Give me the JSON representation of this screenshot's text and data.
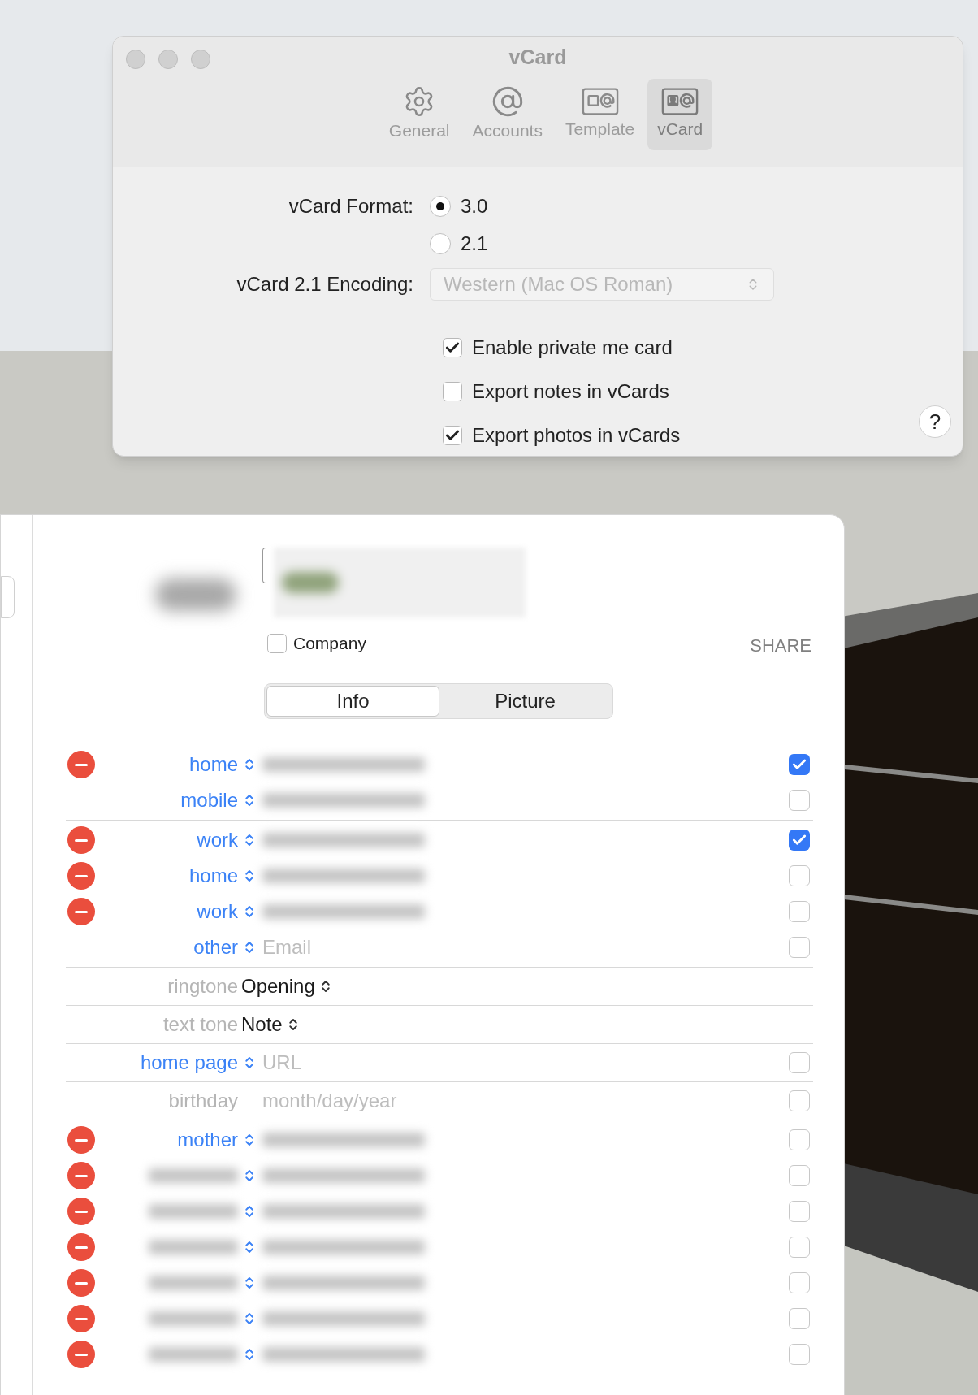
{
  "window": {
    "title": "vCard",
    "toolbar": [
      {
        "label": "General",
        "kind": "gear",
        "selected": false
      },
      {
        "label": "Accounts",
        "kind": "at",
        "selected": false
      },
      {
        "label": "Template",
        "kind": "template",
        "selected": false
      },
      {
        "label": "vCard",
        "kind": "card",
        "selected": true
      }
    ],
    "format_label": "vCard Format:",
    "formats": [
      {
        "label": "3.0",
        "selected": true
      },
      {
        "label": "2.1",
        "selected": false
      }
    ],
    "encoding_label": "vCard 2.1 Encoding:",
    "encoding": {
      "value": "Western (Mac OS Roman)",
      "disabled": true
    },
    "options": [
      {
        "label": "Enable private me card",
        "checked": true
      },
      {
        "label": "Export notes in vCards",
        "checked": false
      },
      {
        "label": "Export photos in vCards",
        "checked": true
      }
    ],
    "help": "?"
  },
  "contact": {
    "company": {
      "label": "Company",
      "checked": false
    },
    "share": "SHARE",
    "segments": [
      {
        "label": "Info",
        "selected": true
      },
      {
        "label": "Picture",
        "selected": false
      }
    ],
    "sections": [
      [
        {
          "kind": "field",
          "label": "home",
          "removable": true,
          "redacted": true,
          "checked": true
        },
        {
          "kind": "field",
          "label": "mobile",
          "removable": false,
          "redacted": true,
          "checked": false
        }
      ],
      [
        {
          "kind": "field",
          "label": "work",
          "removable": true,
          "redacted": true,
          "checked": true
        },
        {
          "kind": "field",
          "label": "home",
          "removable": true,
          "redacted": true,
          "checked": false
        },
        {
          "kind": "field",
          "label": "work",
          "removable": true,
          "redacted": true,
          "checked": false
        },
        {
          "kind": "field",
          "label": "other",
          "removable": false,
          "placeholder": "Email",
          "checked": false
        }
      ],
      [
        {
          "kind": "setting",
          "label": "ringtone",
          "value": "Opening"
        }
      ],
      [
        {
          "kind": "setting",
          "label": "text tone",
          "value": "Note"
        }
      ],
      [
        {
          "kind": "field",
          "label": "home page",
          "removable": false,
          "placeholder": "URL",
          "checked": false
        }
      ],
      [
        {
          "kind": "date",
          "label": "birthday",
          "placeholder": "month/day/year",
          "checked": false
        }
      ],
      [
        {
          "kind": "field",
          "label": "mother",
          "removable": true,
          "redacted": true,
          "checked": false
        },
        {
          "kind": "field",
          "removable": true,
          "redacted": true,
          "checked": false
        },
        {
          "kind": "field",
          "removable": true,
          "redacted": true,
          "checked": false
        },
        {
          "kind": "field",
          "removable": true,
          "redacted": true,
          "checked": false
        },
        {
          "kind": "field",
          "removable": true,
          "redacted": true,
          "checked": false
        },
        {
          "kind": "field",
          "removable": true,
          "redacted": true,
          "checked": false
        },
        {
          "kind": "field",
          "removable": true,
          "redacted": true,
          "checked": false
        }
      ]
    ]
  }
}
